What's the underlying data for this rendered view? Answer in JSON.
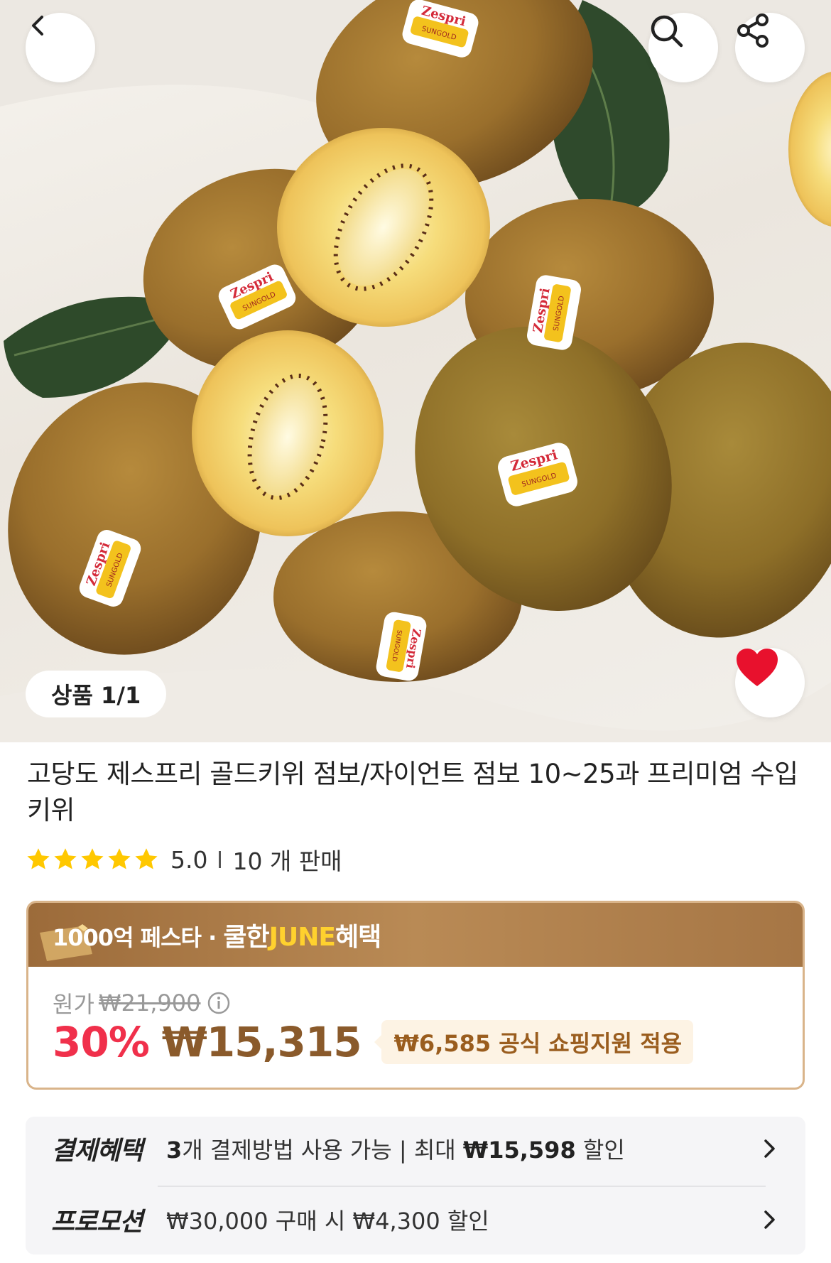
{
  "gallery": {
    "counter": "상품 1/1",
    "sticker_brand": "Zespri",
    "sticker_sub": "SUNGOLD"
  },
  "product": {
    "title": "고당도 제스프리 골드키위 점보/자이언트 점보 10~25과 프리미엄 수입 키위",
    "rating": "5.0",
    "stars": 5,
    "sales": "10 개 판매"
  },
  "price": {
    "promo_prefix": "1000억 페스타 · ",
    "promo_strong": "쿨한",
    "promo_june": "JUNE",
    "promo_suffix": "혜택",
    "original_label": "원가",
    "original_price": "₩21,900",
    "discount": "30%",
    "sale_price": "₩15,315",
    "support": "₩6,585 공식 쇼핑지원 적용"
  },
  "benefits": {
    "payment_label": "결제혜택",
    "payment_count": "3",
    "payment_mid": "개 결제방법 사용 가능 | 최대 ",
    "payment_max": "₩15,598",
    "payment_end": " 할인",
    "promo_label": "프로모션",
    "promo_text": "₩30,000 구매 시 ₩4,300 할인"
  },
  "colors": {
    "accent_red": "#f0304b",
    "price_brown": "#8a5a2b",
    "banner_gold": "#b98a55",
    "june_yellow": "#ffd12e",
    "heart_red": "#e8112d"
  },
  "icons": [
    "back-icon",
    "search-icon",
    "share-icon",
    "heart-icon",
    "star-icon",
    "info-icon",
    "chevron-right-icon",
    "ticket-icon"
  ]
}
